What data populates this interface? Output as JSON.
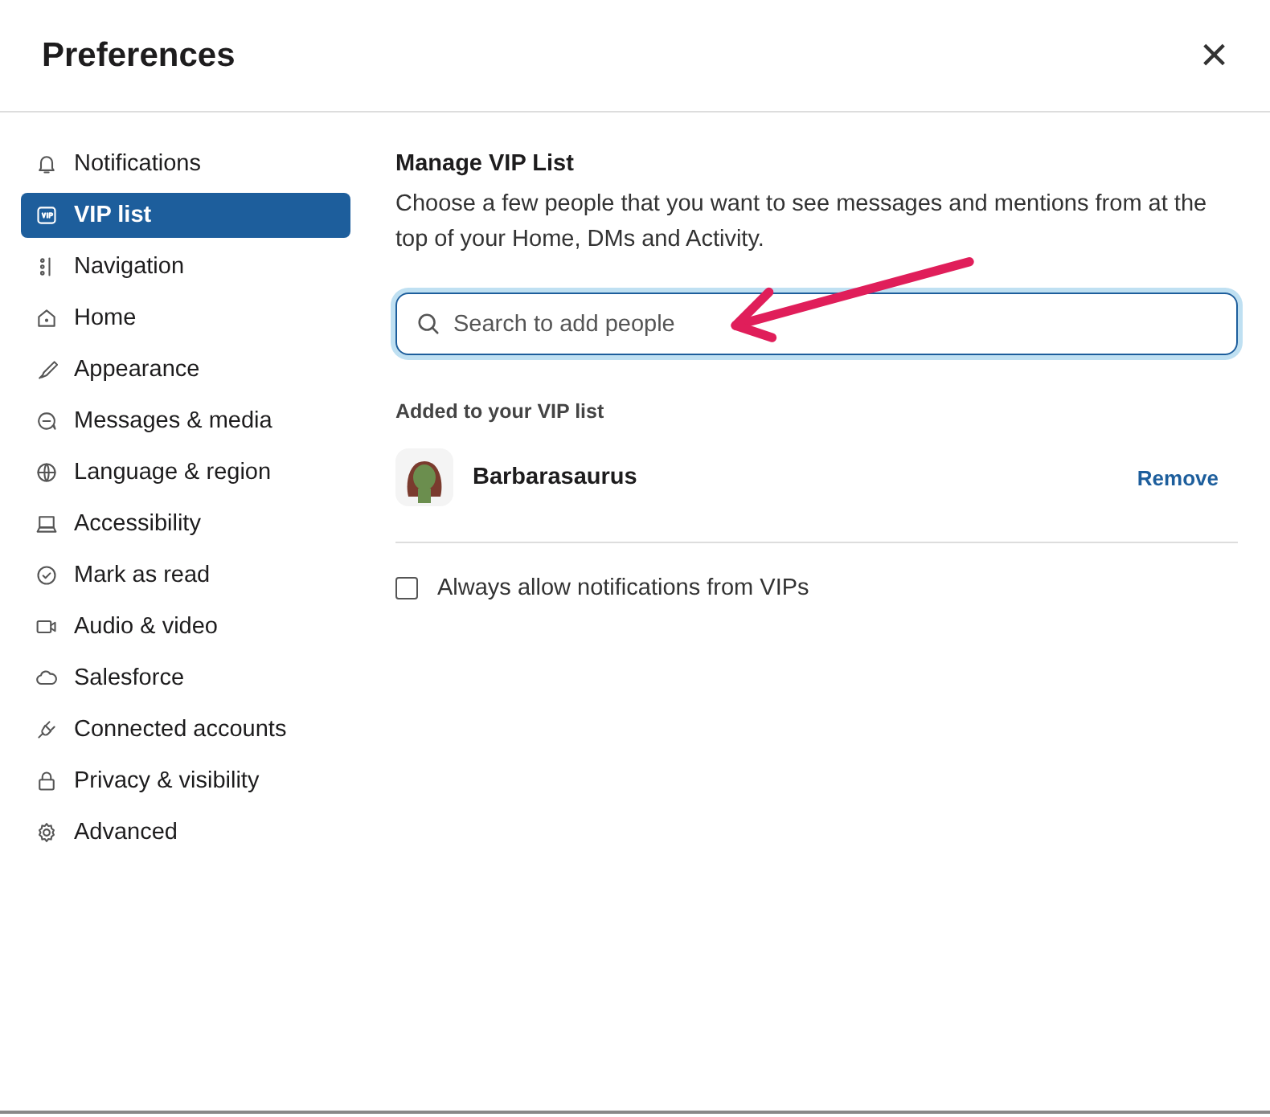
{
  "window": {
    "title": "Preferences",
    "close": "×"
  },
  "sidebar": {
    "items": [
      {
        "label": "Notifications",
        "selected": false
      },
      {
        "label": "VIP list",
        "selected": true
      },
      {
        "label": "Navigation",
        "selected": false
      },
      {
        "label": "Home",
        "selected": false
      },
      {
        "label": "Appearance",
        "selected": false
      },
      {
        "label": "Messages & media",
        "selected": false
      },
      {
        "label": "Language & region",
        "selected": false
      },
      {
        "label": "Accessibility",
        "selected": false
      },
      {
        "label": "Mark as read",
        "selected": false
      },
      {
        "label": "Audio & video",
        "selected": false
      },
      {
        "label": "Salesforce",
        "selected": false
      },
      {
        "label": "Connected accounts",
        "selected": false
      },
      {
        "label": "Privacy & visibility",
        "selected": false
      },
      {
        "label": "Advanced",
        "selected": false
      }
    ]
  },
  "content": {
    "heading": "Manage VIP List",
    "description": "Choose a few people that you want to see messages and mentions from at the top of your Home, DMs and Activity.",
    "search": {
      "placeholder": "Search to add people"
    },
    "added_heading": "Added to your VIP list",
    "people": [
      {
        "name": "Barbarasaurus",
        "action": "Remove"
      }
    ],
    "option": {
      "label": "Always allow notifications from VIPs",
      "checked": false
    }
  }
}
